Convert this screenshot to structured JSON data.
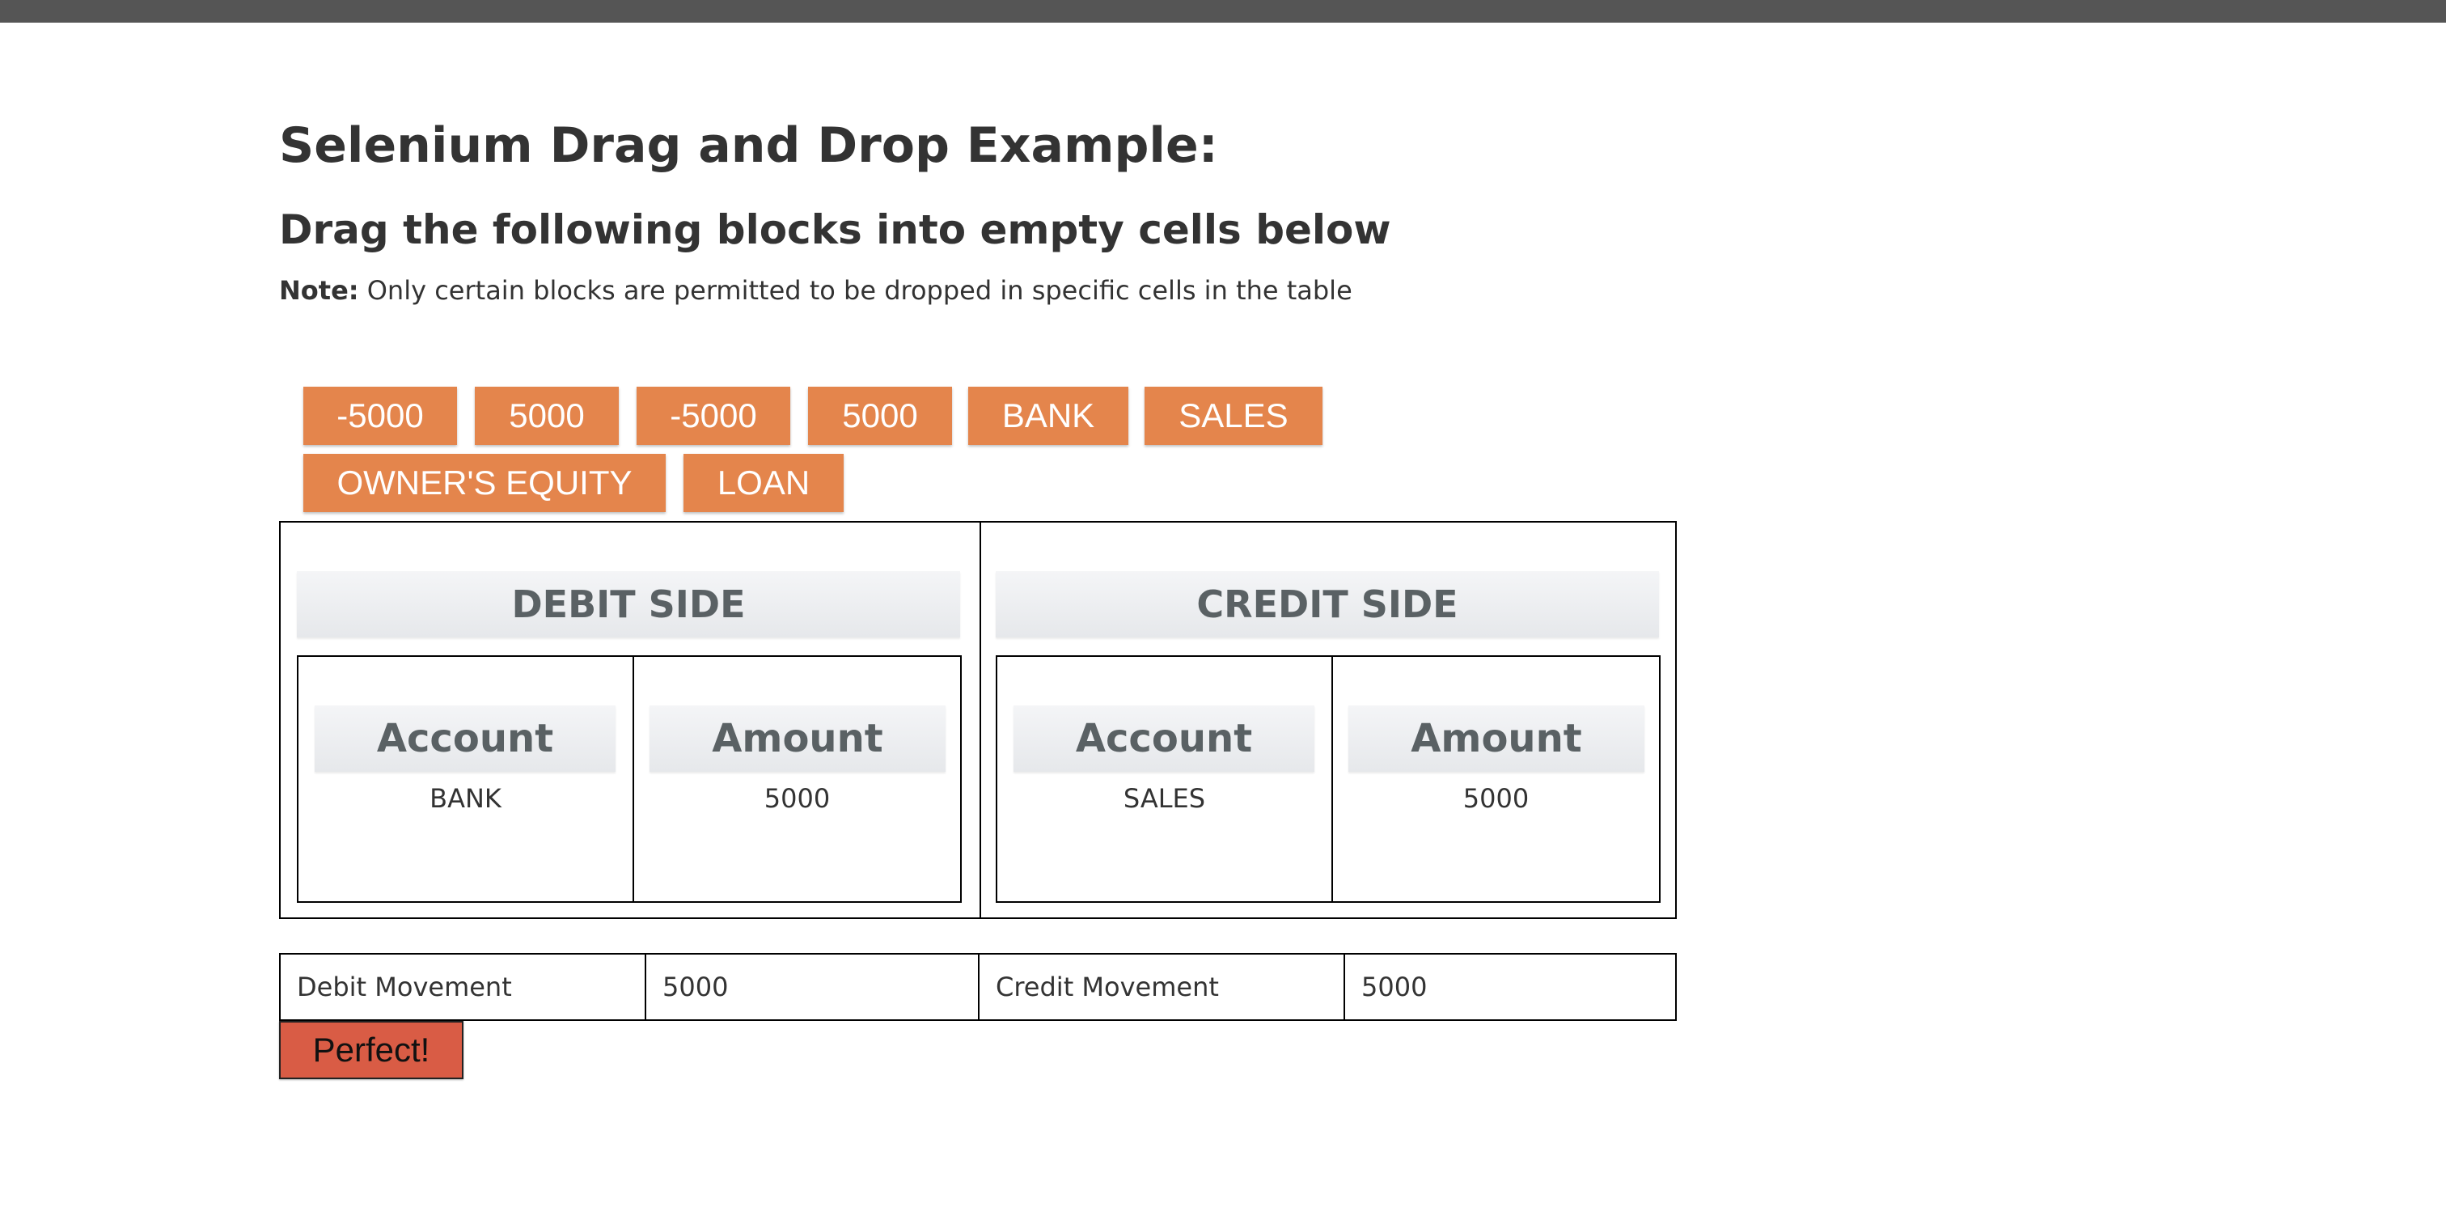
{
  "header": {
    "title": "Selenium Drag and Drop Example:",
    "subtitle": "Drag the following blocks into empty cells below",
    "note_label": "Note:",
    "note_text": " Only certain blocks are permitted to be dropped in specific cells in the table"
  },
  "blocks": [
    "-5000",
    "5000",
    "-5000",
    "5000",
    "BANK",
    "SALES",
    "OWNER'S EQUITY",
    "LOAN"
  ],
  "debit": {
    "title": "DEBIT SIDE",
    "account_header": "Account",
    "amount_header": "Amount",
    "account_value": "BANK",
    "amount_value": "5000"
  },
  "credit": {
    "title": "CREDIT SIDE",
    "account_header": "Account",
    "amount_header": "Amount",
    "account_value": "SALES",
    "amount_value": "5000"
  },
  "movement": {
    "debit_label": "Debit Movement",
    "debit_value": "5000",
    "credit_label": "Credit Movement",
    "credit_value": "5000"
  },
  "result": {
    "label": "Perfect!"
  },
  "colors": {
    "block": "#e4854c",
    "result_button": "#d95c45",
    "topbar": "#555555"
  }
}
